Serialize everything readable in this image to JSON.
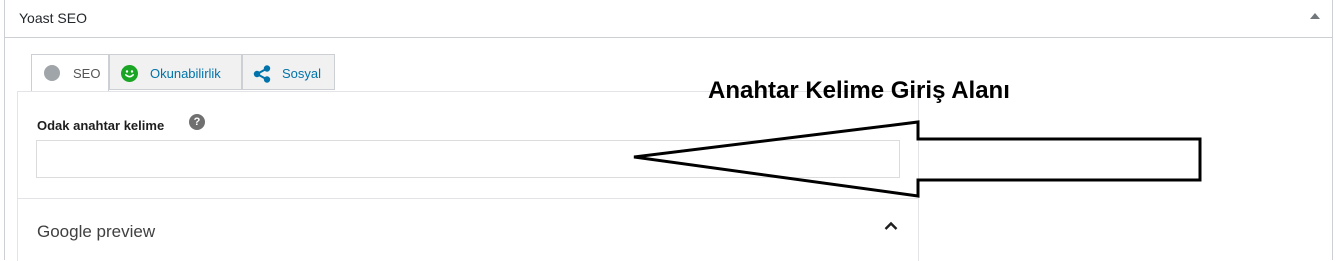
{
  "metabox": {
    "title": "Yoast SEO"
  },
  "tabs": [
    {
      "label": "SEO",
      "icon": "grey-circle-icon",
      "active": true
    },
    {
      "label": "Okunabilirlik",
      "icon": "smiley-icon",
      "active": false
    },
    {
      "label": "Sosyal",
      "icon": "share-icon",
      "active": false
    }
  ],
  "focus_keyword": {
    "label": "Odak anahtar kelime",
    "help_icon": "?",
    "value": "",
    "placeholder": ""
  },
  "google_preview": {
    "title": "Google preview"
  },
  "annotation": {
    "text": "Anahtar Kelime Giriş Alanı"
  },
  "colors": {
    "link": "#0073aa",
    "readability_good": "#1ba524",
    "border": "#ccd0d4"
  }
}
